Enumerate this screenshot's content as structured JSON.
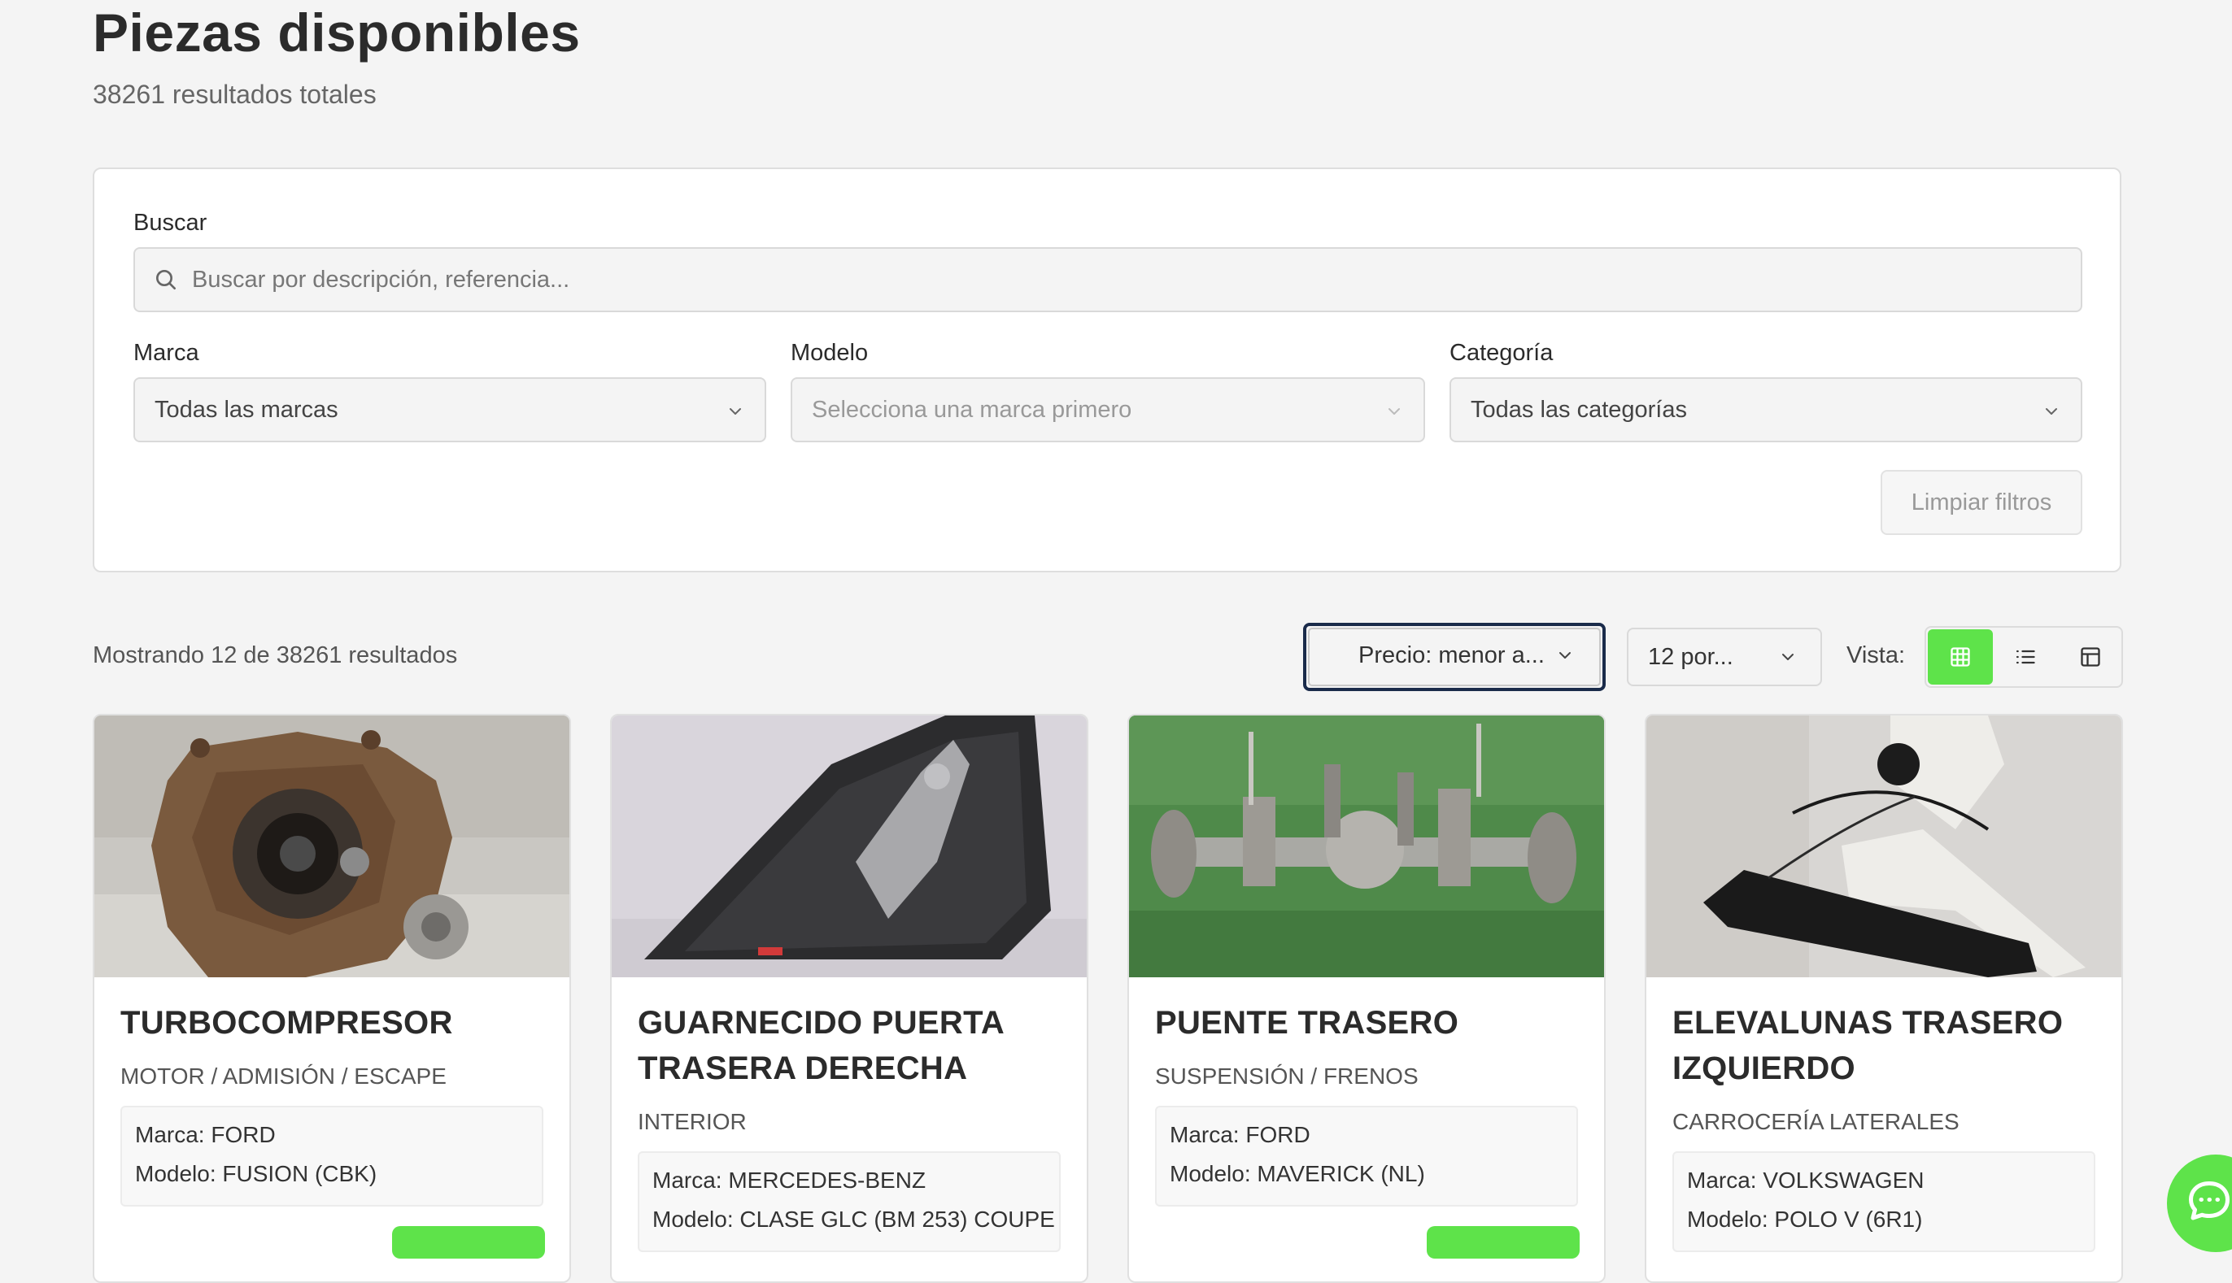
{
  "header": {
    "title": "Piezas disponibles",
    "total_results": "38261 resultados totales"
  },
  "filters": {
    "search_label": "Buscar",
    "search_placeholder": "Buscar por descripción, referencia...",
    "brand_label": "Marca",
    "brand_value": "Todas las marcas",
    "model_label": "Modelo",
    "model_value": "Selecciona una marca primero",
    "category_label": "Categoría",
    "category_value": "Todas las categorías",
    "clear_label": "Limpiar filtros"
  },
  "toolbar": {
    "showing": "Mostrando 12 de 38261 resultados",
    "sort_value": "Precio: menor a...",
    "per_page_value": "12 por...",
    "view_label": "Vista:",
    "active_view": "grid"
  },
  "products": [
    {
      "title": "TURBOCOMPRESOR",
      "category": "MOTOR / ADMISIÓN / ESCAPE",
      "brand": "Marca: FORD",
      "model": "Modelo: FUSION (CBK)"
    },
    {
      "title": "GUARNECIDO PUERTA TRASERA DERECHA",
      "category": "INTERIOR",
      "brand": "Marca: MERCEDES-BENZ",
      "model": "Modelo: CLASE GLC (BM 253) COUPE"
    },
    {
      "title": "PUENTE TRASERO",
      "category": "SUSPENSIÓN / FRENOS",
      "brand": "Marca: FORD",
      "model": "Modelo: MAVERICK (NL)"
    },
    {
      "title": "ELEVALUNAS TRASERO IZQUIERDO",
      "category": "CARROCERÍA LATERALES",
      "brand": "Marca: VOLKSWAGEN",
      "model": "Modelo: POLO V (6R1)"
    }
  ],
  "colors": {
    "accent": "#5ee34a",
    "focus_ring": "#1a2b4a",
    "background": "#f4f4f4"
  }
}
